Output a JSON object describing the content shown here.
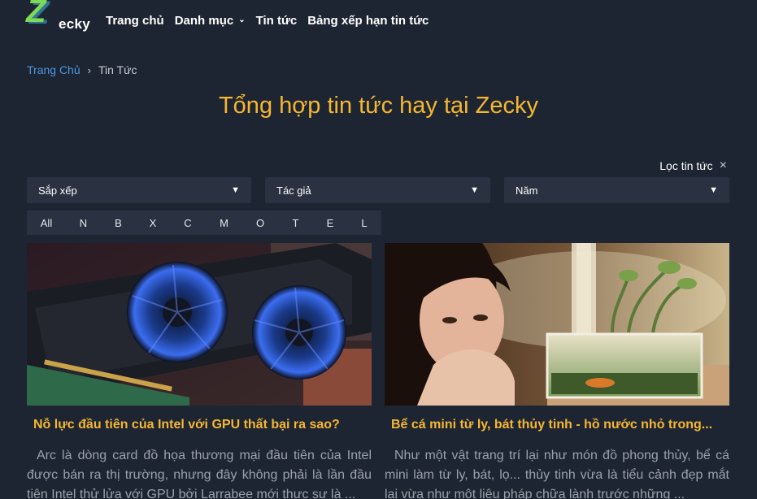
{
  "header": {
    "logo_text": "ecky",
    "nav": [
      {
        "label": "Trang chủ"
      },
      {
        "label": "Danh mục",
        "has_dropdown": true
      },
      {
        "label": "Tin tức"
      },
      {
        "label": "Bảng xếp hạn tin tức"
      }
    ]
  },
  "breadcrumb": {
    "home": "Trang Chủ",
    "separator": "›",
    "current": "Tin Tức"
  },
  "page_title": "Tổng hợp tin tức hay tại Zecky",
  "filter": {
    "toggle_label": "Lọc tin tức",
    "close_icon": "×",
    "selects": [
      {
        "value": "Sắp xếp"
      },
      {
        "value": "Tác giả"
      },
      {
        "value": "Năm"
      }
    ],
    "letters": [
      "All",
      "N",
      "B",
      "X",
      "C",
      "M",
      "O",
      "T",
      "E",
      "L"
    ]
  },
  "articles": [
    {
      "title": "Nỗ lực đầu tiên của Intel với GPU thất bại ra sao?",
      "excerpt": "Arc là dòng card đồ họa thương mại đầu tiên của Intel được bán ra thị trường, nhưng đây không phải là lần đầu tiên Intel thử lửa với GPU bởi Larrabee mới thực sự là ...",
      "image": "graphics-card-photo"
    },
    {
      "title": "Bể cá mini từ ly, bát thủy tinh - hồ nước nhỏ trong...",
      "excerpt": "Như một vật trang trí lại như món đồ phong thủy, bể cá mini làm từ ly, bát, lọ... thủy tinh vừa là tiểu cảnh đẹp mắt lại vừa như một liệu pháp chữa lành trước những ...",
      "image": "girl-with-aquarium-photo"
    }
  ],
  "colors": {
    "background": "#1e2532",
    "accent": "#f5b731",
    "link": "#4a98e0",
    "control_bg": "#2a3140"
  }
}
